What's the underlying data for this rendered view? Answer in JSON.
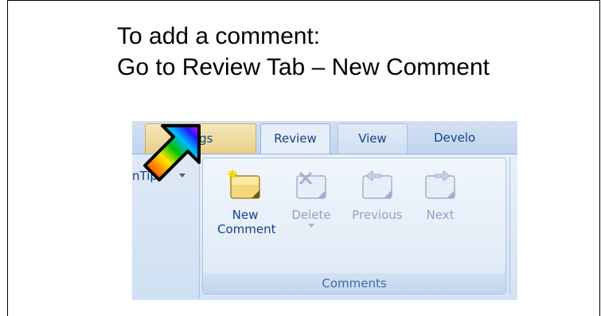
{
  "slide": {
    "title_line1": "To add a comment:",
    "title_line2": "Go to Review Tab – New Comment"
  },
  "ribbon": {
    "tabs": [
      {
        "label": "ings",
        "state": "partial"
      },
      {
        "label": "Review",
        "state": "selected"
      },
      {
        "label": "View",
        "state": "normal"
      },
      {
        "label": "Develo",
        "state": "partial"
      }
    ],
    "left_group_text": "nTip",
    "comments_group": {
      "label": "Comments",
      "buttons": [
        {
          "label_line1": "New",
          "label_line2": "Comment",
          "icon": "new-comment-icon",
          "enabled": true
        },
        {
          "label_line1": "Delete",
          "label_line2": "",
          "icon": "delete-comment-icon",
          "enabled": false
        },
        {
          "label_line1": "Previous",
          "label_line2": "",
          "icon": "previous-comment-icon",
          "enabled": false
        },
        {
          "label_line1": "Next",
          "label_line2": "",
          "icon": "next-comment-icon",
          "enabled": false
        }
      ]
    }
  },
  "colors": {
    "tab_text": "#15428b",
    "disabled_text": "#8fa4c2",
    "group_label": "#3e6aaa"
  },
  "cursor": {
    "icon": "rainbow-arrow-cursor-icon"
  }
}
